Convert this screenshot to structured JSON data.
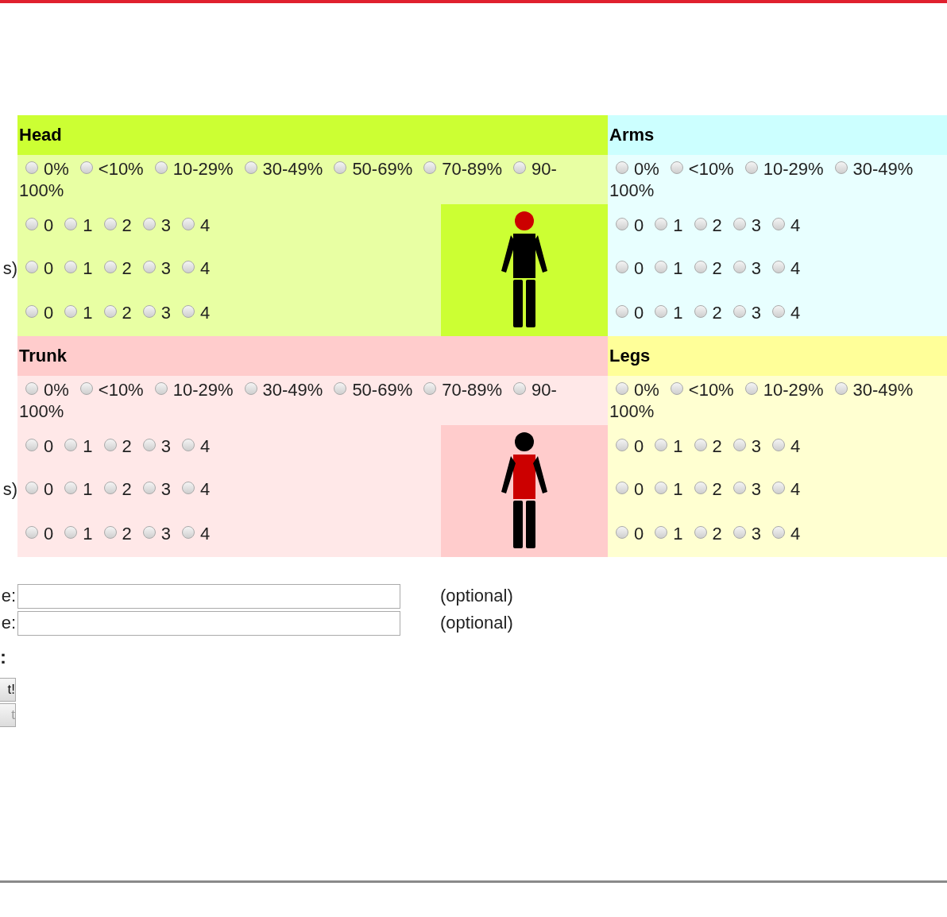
{
  "sections": [
    {
      "name": "Head",
      "kind": "left",
      "color": "#ccff33",
      "figure": {
        "kind": "head"
      },
      "extent": {
        "options": [
          {
            "label": "0%",
            "selected": false
          },
          {
            "label": "<10%",
            "selected": false
          },
          {
            "label": "10-29%",
            "selected": false
          },
          {
            "label": "30-49%",
            "selected": false
          },
          {
            "label": "50-69%",
            "selected": false
          },
          {
            "label": "70-89%",
            "selected": false
          },
          {
            "label": "90-",
            "selected": false
          }
        ],
        "wrapped_text": "100%"
      },
      "scores": [
        {
          "options": [
            {
              "label": "0",
              "selected": false
            },
            {
              "label": "1",
              "selected": false
            },
            {
              "label": "2",
              "selected": false
            },
            {
              "label": "3",
              "selected": false
            },
            {
              "label": "4",
              "selected": false
            }
          ]
        },
        {
          "label": "s)",
          "options": [
            {
              "label": "0",
              "selected": false
            },
            {
              "label": "1",
              "selected": false
            },
            {
              "label": "2",
              "selected": false
            },
            {
              "label": "3",
              "selected": false
            },
            {
              "label": "4",
              "selected": false
            }
          ]
        },
        {
          "options": [
            {
              "label": "0",
              "selected": false
            },
            {
              "label": "1",
              "selected": false
            },
            {
              "label": "2",
              "selected": false
            },
            {
              "label": "3",
              "selected": false
            },
            {
              "label": "4",
              "selected": false
            }
          ]
        }
      ]
    },
    {
      "name": "Arms",
      "kind": "right",
      "color": "#ccffff",
      "extent": {
        "options": [
          {
            "label": "0%",
            "selected": false
          },
          {
            "label": "<10%",
            "selected": false
          },
          {
            "label": "10-29%",
            "selected": false
          },
          {
            "label": "30-49%",
            "selected": false
          }
        ],
        "wrapped_text": "100%"
      },
      "scores": [
        {
          "options": [
            {
              "label": "0",
              "selected": false
            },
            {
              "label": "1",
              "selected": false
            },
            {
              "label": "2",
              "selected": false
            },
            {
              "label": "3",
              "selected": false
            },
            {
              "label": "4",
              "selected": false
            }
          ]
        },
        {
          "options": [
            {
              "label": "0",
              "selected": false
            },
            {
              "label": "1",
              "selected": false
            },
            {
              "label": "2",
              "selected": false
            },
            {
              "label": "3",
              "selected": false
            },
            {
              "label": "4",
              "selected": false
            }
          ]
        },
        {
          "options": [
            {
              "label": "0",
              "selected": false
            },
            {
              "label": "1",
              "selected": false
            },
            {
              "label": "2",
              "selected": false
            },
            {
              "label": "3",
              "selected": false
            },
            {
              "label": "4",
              "selected": false
            }
          ]
        }
      ]
    },
    {
      "name": "Trunk",
      "kind": "left",
      "color": "#ffcccc",
      "figure": {
        "kind": "trunk"
      },
      "extent": {
        "options": [
          {
            "label": "0%",
            "selected": false
          },
          {
            "label": "<10%",
            "selected": false
          },
          {
            "label": "10-29%",
            "selected": false
          },
          {
            "label": "30-49%",
            "selected": false
          },
          {
            "label": "50-69%",
            "selected": false
          },
          {
            "label": "70-89%",
            "selected": false
          },
          {
            "label": "90-",
            "selected": false
          }
        ],
        "wrapped_text": "100%"
      },
      "scores": [
        {
          "options": [
            {
              "label": "0",
              "selected": false
            },
            {
              "label": "1",
              "selected": false
            },
            {
              "label": "2",
              "selected": false
            },
            {
              "label": "3",
              "selected": false
            },
            {
              "label": "4",
              "selected": false
            }
          ]
        },
        {
          "label": "s)",
          "options": [
            {
              "label": "0",
              "selected": false
            },
            {
              "label": "1",
              "selected": false
            },
            {
              "label": "2",
              "selected": false
            },
            {
              "label": "3",
              "selected": false
            },
            {
              "label": "4",
              "selected": false
            }
          ]
        },
        {
          "options": [
            {
              "label": "0",
              "selected": false
            },
            {
              "label": "1",
              "selected": false
            },
            {
              "label": "2",
              "selected": false
            },
            {
              "label": "3",
              "selected": false
            },
            {
              "label": "4",
              "selected": false
            }
          ]
        }
      ]
    },
    {
      "name": "Legs",
      "kind": "right",
      "color": "#ffff99",
      "extent": {
        "options": [
          {
            "label": "0%",
            "selected": false
          },
          {
            "label": "<10%",
            "selected": false
          },
          {
            "label": "10-29%",
            "selected": false
          },
          {
            "label": "30-49%",
            "selected": false
          }
        ],
        "wrapped_text": "100%"
      },
      "scores": [
        {
          "options": [
            {
              "label": "0",
              "selected": false
            },
            {
              "label": "1",
              "selected": false
            },
            {
              "label": "2",
              "selected": false
            },
            {
              "label": "3",
              "selected": false
            },
            {
              "label": "4",
              "selected": false
            }
          ]
        },
        {
          "options": [
            {
              "label": "0",
              "selected": false
            },
            {
              "label": "1",
              "selected": false
            },
            {
              "label": "2",
              "selected": false
            },
            {
              "label": "3",
              "selected": false
            },
            {
              "label": "4",
              "selected": false
            }
          ]
        },
        {
          "options": [
            {
              "label": "0",
              "selected": false
            },
            {
              "label": "1",
              "selected": false
            },
            {
              "label": "2",
              "selected": false
            },
            {
              "label": "3",
              "selected": false
            },
            {
              "label": "4",
              "selected": false
            }
          ]
        }
      ]
    }
  ],
  "fields": [
    {
      "label": "e:",
      "note": "(optional)"
    },
    {
      "label": "e:",
      "note": "(optional)"
    }
  ],
  "result_label": ":",
  "buttons": [
    {
      "label": "t!",
      "disabled": false
    },
    {
      "label": "t",
      "disabled": true
    }
  ]
}
